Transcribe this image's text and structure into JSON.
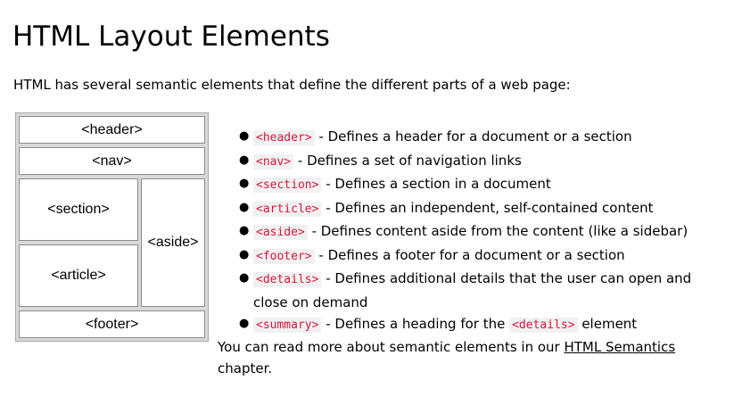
{
  "page": {
    "title": "HTML Layout Elements",
    "intro": "HTML has several semantic elements that define the different parts of a web page:"
  },
  "diagram": {
    "header": "<header>",
    "nav": "<nav>",
    "section": "<section>",
    "article": "<article>",
    "aside": "<aside>",
    "footer": "<footer>"
  },
  "elements": [
    {
      "tag": "<header>",
      "description": " - Defines a header for a document or a section"
    },
    {
      "tag": "<nav>",
      "description": " - Defines a set of navigation links"
    },
    {
      "tag": "<section>",
      "description": " - Defines a section in a document"
    },
    {
      "tag": "<article>",
      "description": " - Defines an independent, self-contained content"
    },
    {
      "tag": "<aside>",
      "description": " - Defines content aside from the content (like a sidebar)"
    },
    {
      "tag": "<footer>",
      "description": " - Defines a footer for a document or a section"
    },
    {
      "tag": "<details>",
      "description": " - Defines additional details that the user can open and close on demand"
    },
    {
      "tag": "<summary>",
      "description": " - Defines a heading for the ",
      "tag2": "<details>",
      "description2": " element"
    }
  ],
  "footer_note": {
    "prefix": "You can read more about semantic elements in our ",
    "link_text": "HTML Semantics",
    "suffix": " chapter."
  },
  "colors": {
    "code_text": "#dc143c",
    "code_background": "#f1f1f1"
  }
}
